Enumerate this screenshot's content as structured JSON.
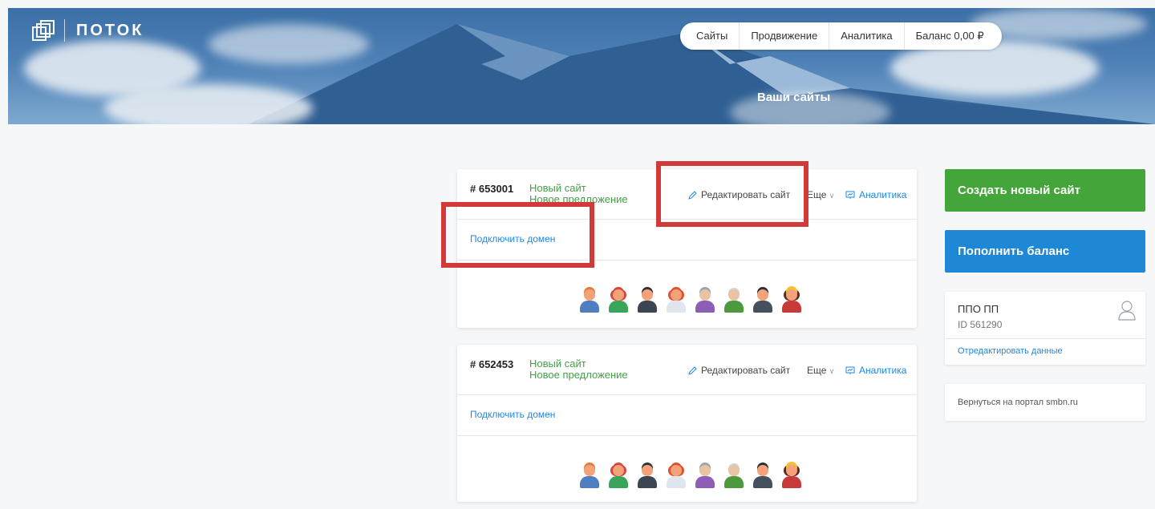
{
  "header": {
    "logo_text": "ПОТОК",
    "nav": [
      "Сайты",
      "Продвижение",
      "Аналитика",
      "Баланс 0,00 ₽"
    ],
    "title": "Ваши сайты"
  },
  "cards": [
    {
      "id": "# 653001",
      "name_line1": "Новый сайт",
      "name_line2": "Новое предложение",
      "edit_label": "Редактировать сайт",
      "more_label": "Еще",
      "analytics_label": "Аналитика",
      "domain_label": "Подключить домен"
    },
    {
      "id": "# 652453",
      "name_line1": "Новый сайт",
      "name_line2": "Новое предложение",
      "edit_label": "Редактировать сайт",
      "more_label": "Еще",
      "analytics_label": "Аналитика",
      "domain_label": "Подключить домен"
    }
  ],
  "sidebar": {
    "create_label": "Создать новый сайт",
    "topup_label": "Пополнить баланс",
    "profile_name": "ППО ПП",
    "profile_id": "ID 561290",
    "edit_profile_label": "Отредактировать данные",
    "portal_label": "Вернуться на портал smbn.ru"
  },
  "colors": {
    "accent_green": "#43a53a",
    "accent_blue": "#1e88d6",
    "link_blue": "#1e88e5",
    "site_name_green": "#43a047",
    "annotation_red": "#d23a3a"
  },
  "avatars": [
    "man-orange-hair",
    "woman-red-hair",
    "man-dark-suit",
    "woman-red-hair-2",
    "grandma-glasses",
    "grandpa-green",
    "man-dark-hair",
    "queen-crown"
  ]
}
